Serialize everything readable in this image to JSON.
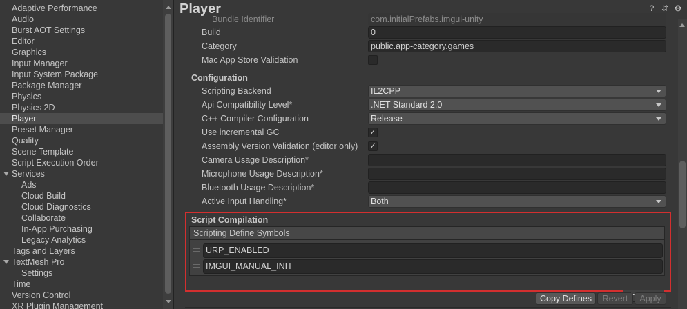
{
  "sidebar": {
    "items": [
      {
        "label": "Adaptive Performance"
      },
      {
        "label": "Audio"
      },
      {
        "label": "Burst AOT Settings"
      },
      {
        "label": "Editor"
      },
      {
        "label": "Graphics"
      },
      {
        "label": "Input Manager"
      },
      {
        "label": "Input System Package"
      },
      {
        "label": "Package Manager"
      },
      {
        "label": "Physics"
      },
      {
        "label": "Physics 2D"
      },
      {
        "label": "Player"
      },
      {
        "label": "Preset Manager"
      },
      {
        "label": "Quality"
      },
      {
        "label": "Scene Template"
      },
      {
        "label": "Script Execution Order"
      },
      {
        "label": "Services"
      },
      {
        "label": "Ads"
      },
      {
        "label": "Cloud Build"
      },
      {
        "label": "Cloud Diagnostics"
      },
      {
        "label": "Collaborate"
      },
      {
        "label": "In-App Purchasing"
      },
      {
        "label": "Legacy Analytics"
      },
      {
        "label": "Tags and Layers"
      },
      {
        "label": "TextMesh Pro"
      },
      {
        "label": "Settings"
      },
      {
        "label": "Time"
      },
      {
        "label": "Version Control"
      },
      {
        "label": "XR Plugin Management"
      }
    ]
  },
  "header": {
    "title": "Player",
    "icons": [
      "help-icon",
      "preset-icon",
      "settings-gear-icon"
    ],
    "help_glyph": "?",
    "preset_glyph": "⇵",
    "gear_glyph": "⚙"
  },
  "settings": {
    "bundle_identifier": {
      "label": "Bundle Identifier",
      "value": "com.initialPrefabs.imgui-unity"
    },
    "build": {
      "label": "Build",
      "value": "0"
    },
    "category": {
      "label": "Category",
      "value": "public.app-category.games"
    },
    "mac_app_store_validation": {
      "label": "Mac App Store Validation",
      "checked": false
    },
    "configuration_header": "Configuration",
    "scripting_backend": {
      "label": "Scripting Backend",
      "value": "IL2CPP"
    },
    "api_compat": {
      "label": "Api Compatibility Level*",
      "value": ".NET Standard 2.0"
    },
    "cpp_compiler": {
      "label": "C++ Compiler Configuration",
      "value": "Release"
    },
    "incremental_gc": {
      "label": "Use incremental GC",
      "checked": true,
      "glyph": "✓"
    },
    "assembly_validation": {
      "label": "Assembly Version Validation (editor only)",
      "checked": true,
      "glyph": "✓"
    },
    "camera_usage": {
      "label": "Camera Usage Description*",
      "value": ""
    },
    "microphone_usage": {
      "label": "Microphone Usage Description*",
      "value": ""
    },
    "bluetooth_usage": {
      "label": "Bluetooth Usage Description*",
      "value": ""
    },
    "active_input": {
      "label": "Active Input Handling*",
      "value": "Both"
    }
  },
  "script_compilation": {
    "header": "Script Compilation",
    "list_header": "Scripting Define Symbols",
    "symbols": [
      "URP_ENABLED",
      "IMGUI_MANUAL_INIT"
    ],
    "plus": "+",
    "minus": "−"
  },
  "buttons": {
    "copy_defines": "Copy Defines",
    "revert": "Revert",
    "apply": "Apply"
  },
  "colors": {
    "highlight_border": "#d32f2f",
    "background": "#383838"
  }
}
